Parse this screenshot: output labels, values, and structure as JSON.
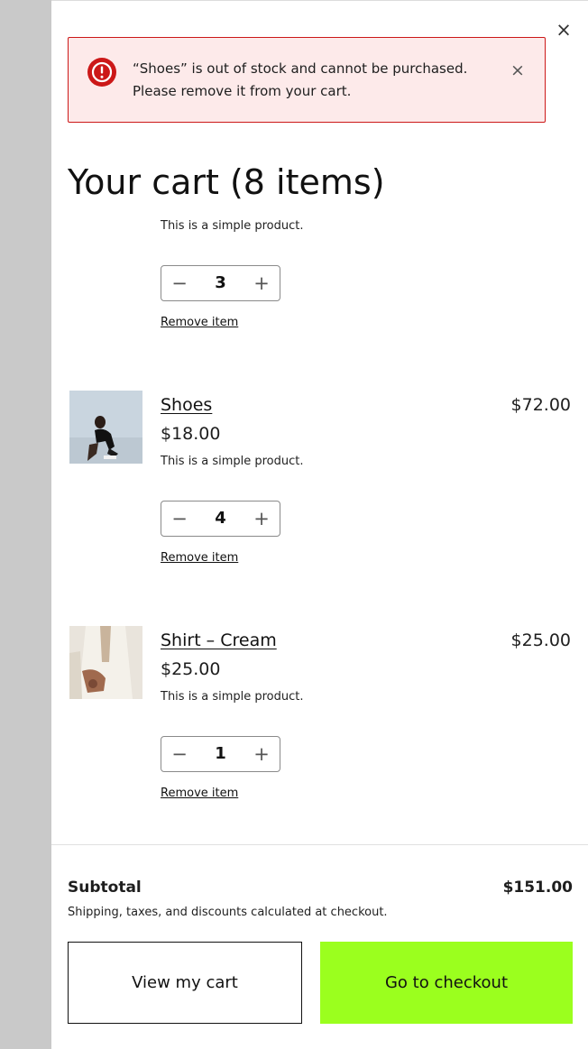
{
  "drawer": {
    "close_icon": "close-icon"
  },
  "notice": {
    "message_line1": "“Shoes” is out of stock and cannot be purchased.",
    "message_line2": "Please remove it from your cart.",
    "icon": "error-icon",
    "close_icon": "close-icon",
    "accent_color": "#cc1818",
    "background_color": "#fdeaea"
  },
  "cart": {
    "title": "Your cart (8 items)",
    "items": [
      {
        "name": "",
        "unit_price": "",
        "description": "This is a simple product.",
        "quantity": "3",
        "remove_label": "Remove item",
        "line_total": ""
      },
      {
        "name": "Shoes",
        "unit_price": "$18.00",
        "description": "This is a simple product.",
        "quantity": "4",
        "remove_label": "Remove item",
        "line_total": "$72.00"
      },
      {
        "name": "Shirt – Cream",
        "unit_price": "$25.00",
        "description": "This is a simple product.",
        "quantity": "1",
        "remove_label": "Remove item",
        "line_total": "$25.00"
      }
    ],
    "qty_minus_symbol": "−",
    "qty_plus_symbol": "+"
  },
  "footer": {
    "subtotal_label": "Subtotal",
    "subtotal_value": "$151.00",
    "note": "Shipping, taxes, and discounts calculated at checkout.",
    "view_cart_label": "View my cart",
    "checkout_label": "Go to checkout",
    "checkout_color": "#9bff1e"
  }
}
